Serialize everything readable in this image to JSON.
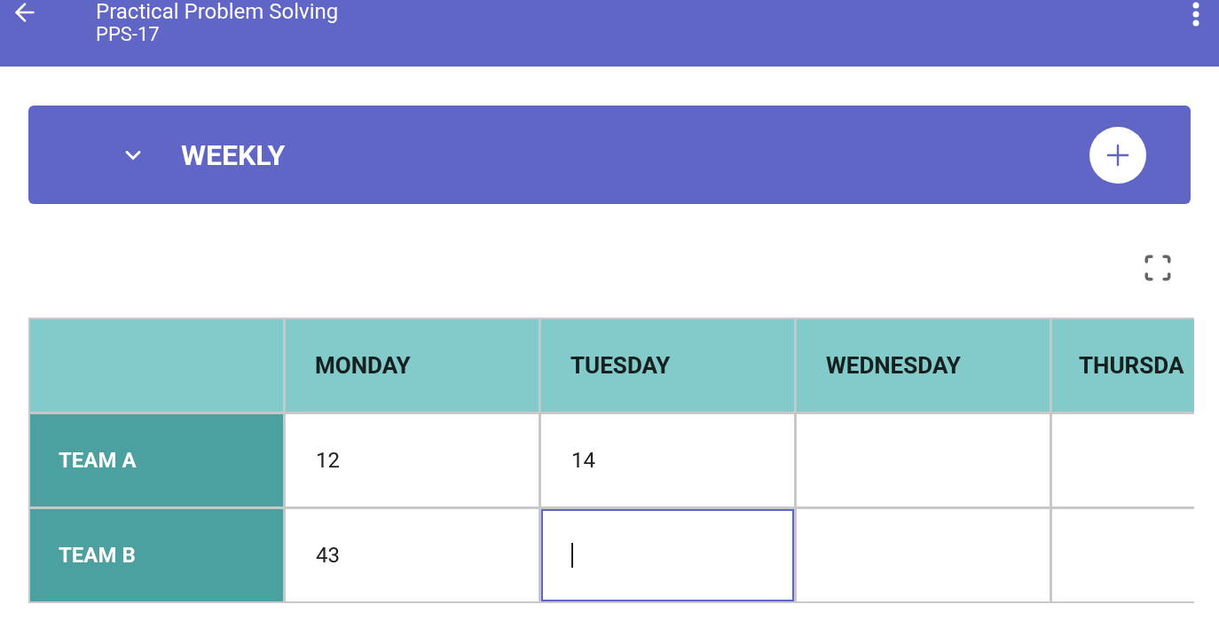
{
  "app_bar": {
    "title": "Practical Problem Solving",
    "subtitle": "PPS-17"
  },
  "section": {
    "title": "WEEKLY",
    "expanded": true
  },
  "table": {
    "columns": [
      "MONDAY",
      "TUESDAY",
      "WEDNESDAY",
      "THURSDA"
    ],
    "rows": [
      {
        "label": "TEAM A",
        "cells": [
          {
            "value": "12",
            "selected": false
          },
          {
            "value": "14",
            "selected": false
          },
          {
            "selected": false
          },
          {
            "selected": false
          }
        ]
      },
      {
        "label": "TEAM B",
        "cells": [
          {
            "value": "43",
            "selected": false
          },
          {
            "selected": true
          },
          {
            "selected": false
          },
          {
            "selected": false
          }
        ]
      }
    ]
  }
}
